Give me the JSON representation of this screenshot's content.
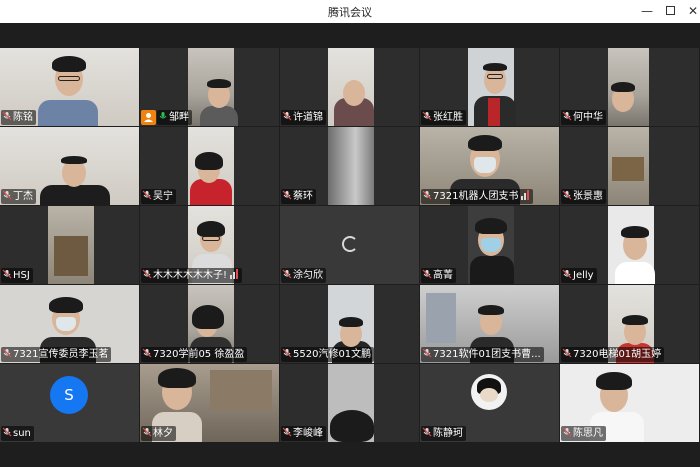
{
  "window": {
    "title": "腾讯会议",
    "minimize_glyph": "—",
    "close_glyph": "✕"
  },
  "colors": {
    "speaking_outline": "#2fbf55",
    "host_badge": "#f0820f",
    "avatar_blue": "#1677f3"
  },
  "participants": [
    {
      "name": "陈铭"
    },
    {
      "name": "邹畔"
    },
    {
      "name": "许道锦"
    },
    {
      "name": "张红胜"
    },
    {
      "name": "何中华"
    },
    {
      "name": "丁杰"
    },
    {
      "name": "吴宁"
    },
    {
      "name": "蔡环"
    },
    {
      "name": "7321机器人团支书"
    },
    {
      "name": "张景惠"
    },
    {
      "name": "HSJ"
    },
    {
      "name": "木木木木木木子!"
    },
    {
      "name": "涂匀欣"
    },
    {
      "name": "高菁"
    },
    {
      "name": "Jelly"
    },
    {
      "name": "7321宣传委员李玉茗"
    },
    {
      "name": "7320学前05 徐盈盈"
    },
    {
      "name": "5520汽修01文鹏"
    },
    {
      "name": "7321软件01团支书曹..."
    },
    {
      "name": "7320电梯01胡玉婷"
    },
    {
      "name": "sun",
      "avatar_letter": "S"
    },
    {
      "name": "林夕"
    },
    {
      "name": "李峻峰"
    },
    {
      "name": "陈静珂"
    },
    {
      "name": "陈思凡"
    }
  ]
}
